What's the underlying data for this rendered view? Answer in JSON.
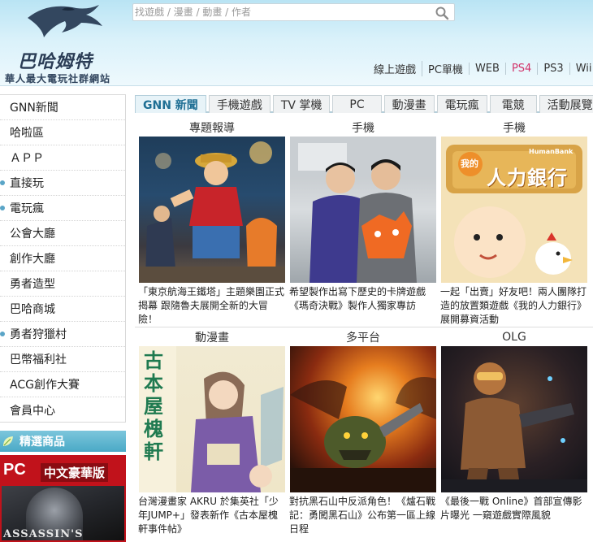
{
  "header": {
    "logo_text": "巴哈姆特",
    "slogan": "華人最大電玩社群網站",
    "search_placeholder": "找遊戲 / 漫畫 / 動畫 / 作者",
    "platforms": [
      {
        "label": "線上遊戲"
      },
      {
        "label": "PC單機"
      },
      {
        "label": "WEB"
      },
      {
        "label": "PS4"
      },
      {
        "label": "PS3"
      },
      {
        "label": "Wii"
      }
    ],
    "highlight_color": "#d2336a"
  },
  "sidebar": {
    "items": [
      {
        "label": "GNN新聞"
      },
      {
        "label": "哈啦區"
      },
      {
        "label": "ＡＰＰ"
      },
      {
        "label": "直接玩"
      },
      {
        "label": "電玩瘋"
      },
      {
        "label": "公會大廳"
      },
      {
        "label": "創作大廳"
      },
      {
        "label": "勇者造型"
      },
      {
        "label": "巴哈商城"
      },
      {
        "label": "勇者狩獵村"
      },
      {
        "label": "巴幣福利社"
      },
      {
        "label": "ACG創作大賽"
      },
      {
        "label": "會員中心"
      }
    ],
    "featured_title": "精選商品",
    "featured_pc": "PC",
    "featured_edition": "中文豪華版",
    "featured_game": "ASSASSIN'S"
  },
  "tabs": [
    {
      "label": "GNN 新聞",
      "active": true
    },
    {
      "label": "手機遊戲"
    },
    {
      "label": "TV 掌機"
    },
    {
      "label": "PC"
    },
    {
      "label": "動漫畫"
    },
    {
      "label": "電玩瘋"
    },
    {
      "label": "電競"
    },
    {
      "label": "活動展覽"
    }
  ],
  "news": [
    {
      "category": "專題報導",
      "caption": "「東京航海王鐵塔」主題樂園正式揭幕 跟隨魯夫展開全新的大冒險！"
    },
    {
      "category": "手機",
      "caption": "希望製作出寫下歷史的卡牌遊戲《瑪奇決戰》製作人獨家專訪"
    },
    {
      "category": "手機",
      "caption": "一起「出賣」好友吧！兩人團隊打造的放置類遊戲《我的人力銀行》展開募資活動",
      "image_title": "我的",
      "image_main": "人力銀行",
      "image_brand": "HumanBank"
    },
    {
      "category": "動漫畫",
      "caption": "台灣漫畫家 AKRU 於集英社「少年JUMP+」發表新作《古本屋槐軒事件帖》",
      "image_title": "古本屋槐軒"
    },
    {
      "category": "多平台",
      "caption": "對抗黑石山中反派角色！《爐石戰記：勇闖黑石山》公布第一區上線日程"
    },
    {
      "category": "OLG",
      "caption": "《最後一戰 Online》首部宣傳影片曝光 一窺遊戲實際風貌"
    }
  ]
}
